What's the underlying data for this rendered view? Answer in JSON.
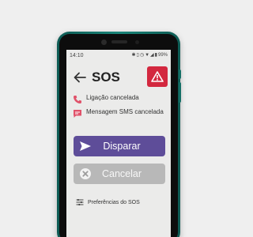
{
  "statusbar": {
    "time": "14:10",
    "battery": "99%",
    "icons": [
      "bluetooth-icon",
      "vibrate-icon",
      "alarm-icon",
      "wifi-icon",
      "signal-icon",
      "battery-icon"
    ]
  },
  "header": {
    "title": "SOS",
    "back_icon": "arrow-left-icon",
    "alert_icon": "warning-icon"
  },
  "statuses": [
    {
      "icon": "phone-icon",
      "text": "Ligação cancelada"
    },
    {
      "icon": "message-icon",
      "text": "Mensagem SMS cancelada"
    }
  ],
  "actions": {
    "send_label": "Disparar",
    "cancel_label": "Cancelar"
  },
  "footer": {
    "prefs_label": "Preferências do SOS",
    "prefs_icon": "sliders-icon"
  },
  "colors": {
    "phone_body": "#1a8579",
    "alert": "#d3283f",
    "send_button": "#5e4d99",
    "cancel_button": "#b8b8b8",
    "status_icon": "#e0526a",
    "screen_bg": "#ebebea"
  }
}
